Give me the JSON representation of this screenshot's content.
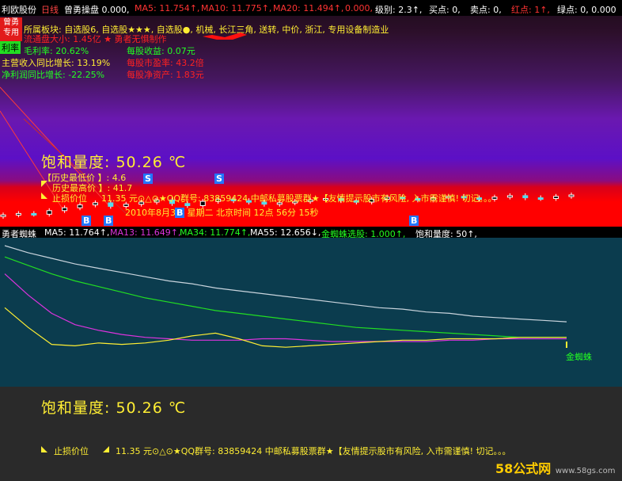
{
  "topbar": {
    "stock": "利欧股份",
    "period": "日线",
    "indicator": "曾勇操盘 0.000,",
    "ma5": "MA5: 11.754↑,",
    "ma10": "MA10: 11.775↑,",
    "ma20": "MA20: 11.494↑,",
    "zero": "0.000,",
    "level": "级别: 2.3↑,",
    "buy": "买点: 0,",
    "sell": "卖点: 0,",
    "red": "红点: 1↑,",
    "green": "绿点: 0, 0.000"
  },
  "badge": {
    "line1": "曾勇",
    "line2": "专用"
  },
  "info": {
    "sector": "所属板块: 自选股6, 自选股★★★, 自选股●, 机械, 长江三角, 送转, 中价, 浙江, 专用设备制造业",
    "circulation": "流通盘大小: 1.45亿 ★  勇者无惧制作",
    "margin_label": "利率",
    "margin": "毛利率: 20.62%",
    "eps": "每股收益: 0.07元",
    "revenue_growth": "主营收入同比增长: 13.19%",
    "pe": "每股市盈率: 43.2倍",
    "profit_growth": "净利润同比增长: -22.25%",
    "nav": "每股净资产: 1.83元"
  },
  "chart_upper": {
    "saturation": "饱和量度: 50.26 ℃",
    "hist_low": "【历史最低价 】: 4.6",
    "hist_high": "历史最高价 】: 41.7",
    "stop_loss": "止损价位",
    "ad_line": "11.35 元⊙△⊙★QQ群号: 83859424 中邮私募股票群★【友情提示股市有风险, 入市需谨慎! 切记。。。",
    "date_line": "2010年8月3日 星期二 北京时间 12点 56分 15秒",
    "marks": [
      "S",
      "S",
      "B",
      "B",
      "B",
      "B"
    ]
  },
  "lower_panel": {
    "name": "勇者蜘蛛",
    "ma5": "MA5: 11.764↑,",
    "ma13": "MA13: 11.649↑,",
    "ma34": "MA34: 11.774↑,",
    "ma55": "MA55: 12.656↓,",
    "spider": "金蜘蛛选股: 1.000↑,",
    "sat": "饱和量度: 50↑,",
    "legend_spider": "金蜘蛛"
  },
  "bottom": {
    "saturation": "饱和量度: 50.26 ℃",
    "stop_loss": "止损价位",
    "ad_line": "11.35 元⊙△⊙★QQ群号: 83859424 中邮私募股票群★【友情提示股市有风险, 入市需谨慎! 切记。。。"
  },
  "watermark": {
    "left": "58公式网",
    "right": "www.58gs.com"
  },
  "colors": {
    "white_line": "#c9d4dd",
    "green_line": "#22dd22",
    "magenta_line": "#dd33dd",
    "yellow_line": "#ffee33",
    "red_text": "#ff2222",
    "yellow_text": "#ffee33",
    "cyan": "#00ffff"
  },
  "chart_data": [
    {
      "type": "line",
      "series": [
        {
          "values": [
            100,
            95,
            91,
            87,
            84,
            81,
            78,
            75,
            73,
            70,
            68,
            66,
            64,
            62,
            60,
            58,
            56,
            55,
            53,
            52,
            50,
            49,
            48,
            47,
            46
          ]
        },
        {
          "values": [
            92,
            86,
            80,
            75,
            71,
            67,
            63,
            60,
            57,
            54,
            52,
            50,
            48,
            46,
            44,
            42,
            41,
            40,
            39,
            38,
            37,
            36,
            35,
            35,
            35
          ]
        },
        {
          "values": [
            80,
            65,
            52,
            44,
            40,
            37,
            35,
            34,
            33,
            33,
            33,
            34,
            34,
            33,
            32,
            32,
            32,
            32,
            32,
            33,
            33,
            34,
            34,
            34,
            34
          ]
        },
        {
          "values": [
            56,
            42,
            30,
            29,
            31,
            30,
            31,
            33,
            36,
            38,
            34,
            29,
            28,
            29,
            30,
            31,
            32,
            33,
            33,
            34,
            34,
            34,
            35,
            35,
            35
          ]
        }
      ]
    },
    {
      "type": "candlestick",
      "values": [
        12,
        14,
        13,
        18,
        22,
        26,
        29,
        24,
        27,
        30,
        33,
        28,
        25,
        31,
        34,
        32,
        30,
        27,
        29,
        31,
        33,
        35,
        32,
        30,
        34,
        37,
        35,
        33,
        36,
        38,
        36,
        34,
        37,
        39,
        36,
        35,
        38,
        40
      ]
    }
  ]
}
